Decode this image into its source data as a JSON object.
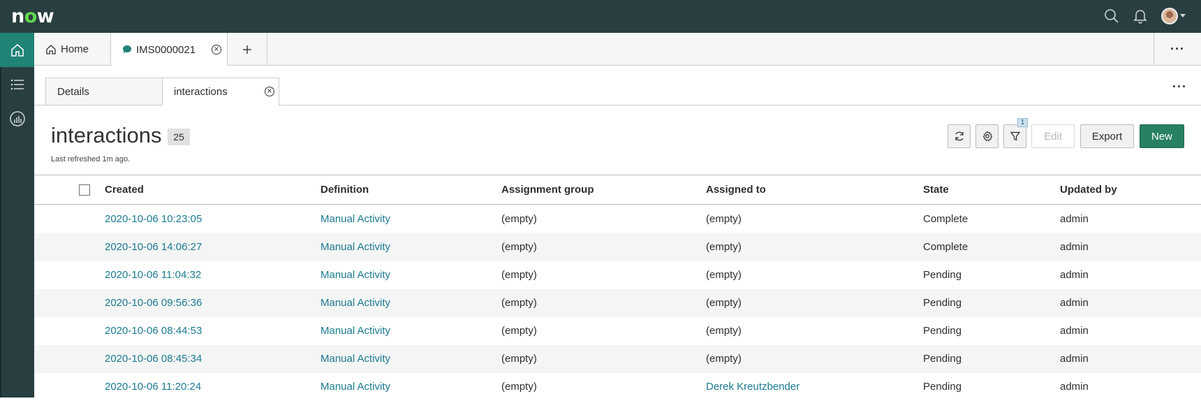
{
  "header": {
    "logo": "now",
    "icons": [
      "search-icon",
      "bell-icon",
      "avatar"
    ],
    "accent": "#293e40"
  },
  "leftnav": {
    "items": [
      "home-icon",
      "list-icon",
      "analytics-icon"
    ],
    "active_color": "#1f8476"
  },
  "tabs": [
    {
      "label": "Home",
      "icon": "home-icon"
    },
    {
      "label": "IMS0000021",
      "icon": "chat-bubble-icon",
      "closable": true
    },
    {
      "label": "+",
      "icon": "plus-icon"
    }
  ],
  "tabbar_more": "···",
  "subtabs": [
    {
      "label": "Details"
    },
    {
      "label": "interactions",
      "closable": true
    }
  ],
  "subtabs_more": "···",
  "list": {
    "title": "interactions",
    "count": "25",
    "refreshed": "Last refreshed 1m ago.",
    "filter_count": "1",
    "buttons": {
      "edit": "Edit",
      "export": "Export",
      "new": "New"
    },
    "new_color": "#278062"
  },
  "table": {
    "columns": [
      "Created",
      "Definition",
      "Assignment group",
      "Assigned to",
      "State",
      "Updated by"
    ],
    "rows": [
      {
        "created": "2020-10-06 10:23:05",
        "definition": "Manual Activity",
        "group": "(empty)",
        "assigned": "(empty)",
        "state": "Complete",
        "updated_by": "admin"
      },
      {
        "created": "2020-10-06 14:06:27",
        "definition": "Manual Activity",
        "group": "(empty)",
        "assigned": "(empty)",
        "state": "Complete",
        "updated_by": "admin"
      },
      {
        "created": "2020-10-06 11:04:32",
        "definition": "Manual Activity",
        "group": "(empty)",
        "assigned": "(empty)",
        "state": "Pending",
        "updated_by": "admin"
      },
      {
        "created": "2020-10-06 09:56:36",
        "definition": "Manual Activity",
        "group": "(empty)",
        "assigned": "(empty)",
        "state": "Pending",
        "updated_by": "admin"
      },
      {
        "created": "2020-10-06 08:44:53",
        "definition": "Manual Activity",
        "group": "(empty)",
        "assigned": "(empty)",
        "state": "Pending",
        "updated_by": "admin"
      },
      {
        "created": "2020-10-06 08:45:34",
        "definition": "Manual Activity",
        "group": "(empty)",
        "assigned": "(empty)",
        "state": "Pending",
        "updated_by": "admin"
      },
      {
        "created": "2020-10-06 11:20:24",
        "definition": "Manual Activity",
        "group": "(empty)",
        "assigned": "Derek Kreutzbender",
        "state": "Pending",
        "updated_by": "admin"
      }
    ]
  }
}
